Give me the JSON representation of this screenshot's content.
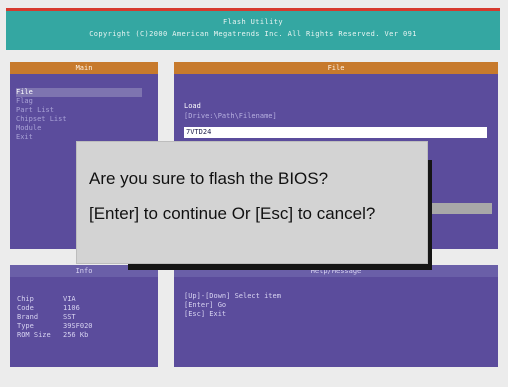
{
  "titlebar": {
    "title": "Flash Utility",
    "copyright": "Copyright (C)2000 American Megatrends Inc. All Rights Reserved. Ver 091"
  },
  "main_panel": {
    "header": "Main",
    "items": [
      "File",
      "Flag",
      "Part List",
      "Chipset List",
      "Module",
      "Exit"
    ],
    "active_index": 0
  },
  "file_panel": {
    "header": "File",
    "load_label": "Load",
    "path_hint": "[Drive:\\Path\\Filename]",
    "input_value": "7VTD24"
  },
  "info_panel": {
    "header": "Info",
    "rows": [
      {
        "label": "Chip",
        "value": "VIA"
      },
      {
        "label": "Code",
        "value": "1106"
      },
      {
        "label": "Brand",
        "value": "SST"
      },
      {
        "label": "Type",
        "value": "39SF020"
      },
      {
        "label": "ROM Size",
        "value": "256 Kb"
      }
    ]
  },
  "help_panel": {
    "header": "Help/Message",
    "lines": [
      "[Up]-[Down] Select item",
      "[Enter] Go",
      "[Esc] Exit"
    ]
  },
  "dialog": {
    "line1": "Are you sure to flash the BIOS?",
    "line2": "[Enter] to continue Or [Esc] to cancel?"
  }
}
